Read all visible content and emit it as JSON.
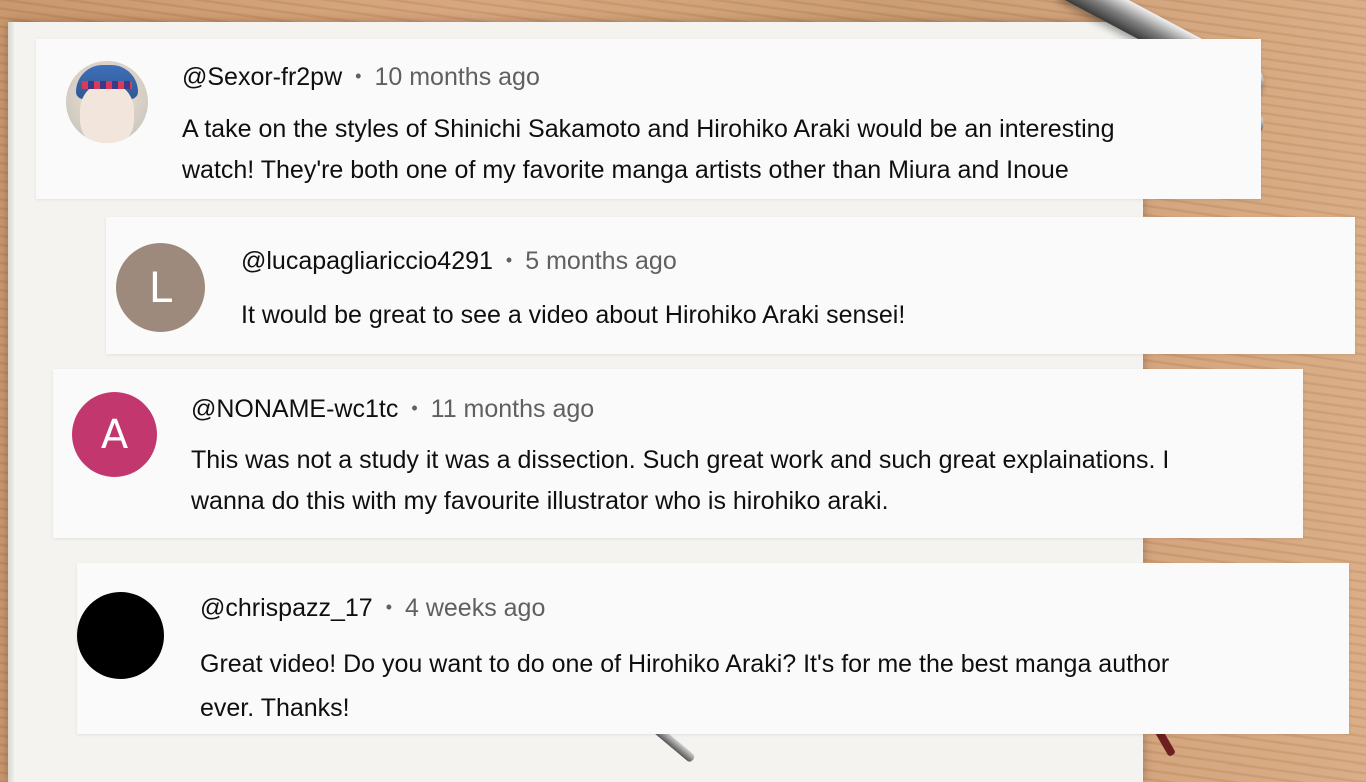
{
  "comments": [
    {
      "handle": "@Sexor-fr2pw",
      "separator": "•",
      "time": "10 months ago",
      "avatar_initial": "",
      "avatar_color": "#d8cfc5",
      "lines": [
        "A take on the styles of Shinichi Sakamoto and Hirohiko Araki would be an interesting",
        "watch! They're both one of my favorite manga artists other than Miura and Inoue"
      ]
    },
    {
      "handle": "@lucapagliariccio4291",
      "separator": "•",
      "time": "5 months ago",
      "avatar_initial": "L",
      "avatar_color": "#9e8a7d",
      "lines": [
        "It would be great to see a video about Hirohiko Araki sensei!"
      ]
    },
    {
      "handle": "@NONAME-wc1tc",
      "separator": "•",
      "time": "11 months ago",
      "avatar_initial": "A",
      "avatar_color": "#c2386e",
      "lines": [
        "This was not a study it was a dissection. Such great work and such great explainations. I",
        "wanna do this with my favourite illustrator who is hirohiko araki."
      ]
    },
    {
      "handle": "@chrispazz_17",
      "separator": "•",
      "time": "4 weeks ago",
      "avatar_initial": "",
      "avatar_color": "#000000",
      "lines": [
        "Great video! Do you want to do one of Hirohiko Araki? It's for me the best manga author",
        "ever. Thanks!"
      ]
    }
  ]
}
